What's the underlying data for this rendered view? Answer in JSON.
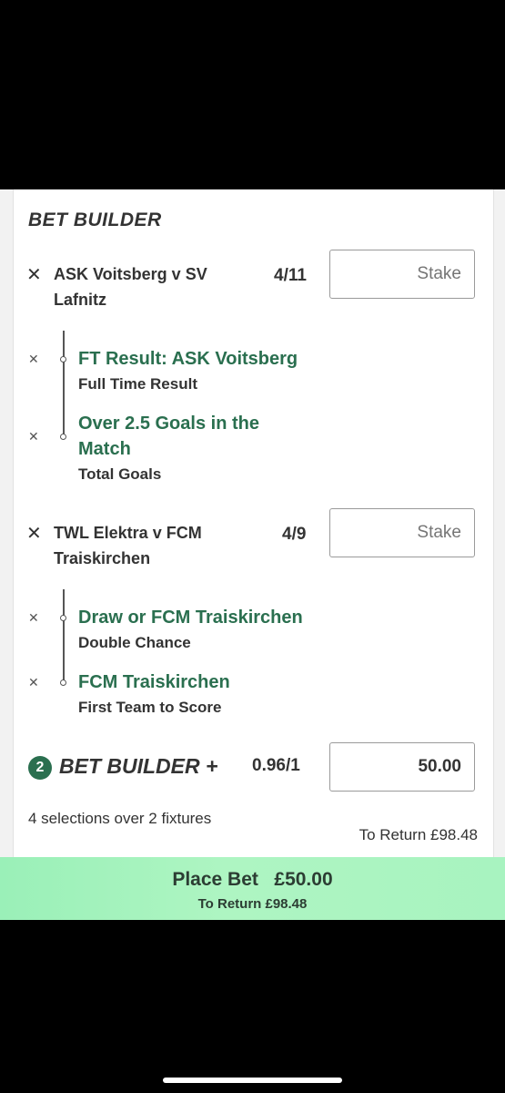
{
  "section_title": "BET BUILDER",
  "fixtures": [
    {
      "name_line1": "ASK Voitsberg v SV",
      "name_line2": "Lafnitz",
      "odds": "4/11",
      "stake_placeholder": "Stake",
      "legs": [
        {
          "selection_line1": "FT Result: ASK Voitsberg",
          "selection_line2": "",
          "market": "Full Time Result"
        },
        {
          "selection_line1": "Over 2.5 Goals in the",
          "selection_line2": "Match",
          "market": "Total Goals"
        }
      ]
    },
    {
      "name_line1": "TWL Elektra v FCM",
      "name_line2": "Traiskirchen",
      "odds": "4/9",
      "stake_placeholder": "Stake",
      "legs": [
        {
          "selection_line1": "Draw or FCM Traiskirchen",
          "selection_line2": "",
          "market": "Double Chance"
        },
        {
          "selection_line1": "FCM Traiskirchen",
          "selection_line2": "",
          "market": "First Team to Score"
        }
      ]
    }
  ],
  "bet_builder_plus": {
    "count": "2",
    "label": "BET BUILDER +",
    "odds": "0.96/1",
    "stake_value": "50.00"
  },
  "selections_summary": "4 selections over 2 fixtures",
  "to_return": "To Return £98.48",
  "place_bet": {
    "label": "Place Bet   £50.00",
    "to_return": "To Return £98.48"
  },
  "icons": {
    "remove": "close-icon",
    "leg_remove": "small-close-icon",
    "leg_dot": "timeline-dot-icon"
  },
  "colors": {
    "accent_green": "#2a6f4f",
    "place_bet_green": "#a8f3c0"
  }
}
